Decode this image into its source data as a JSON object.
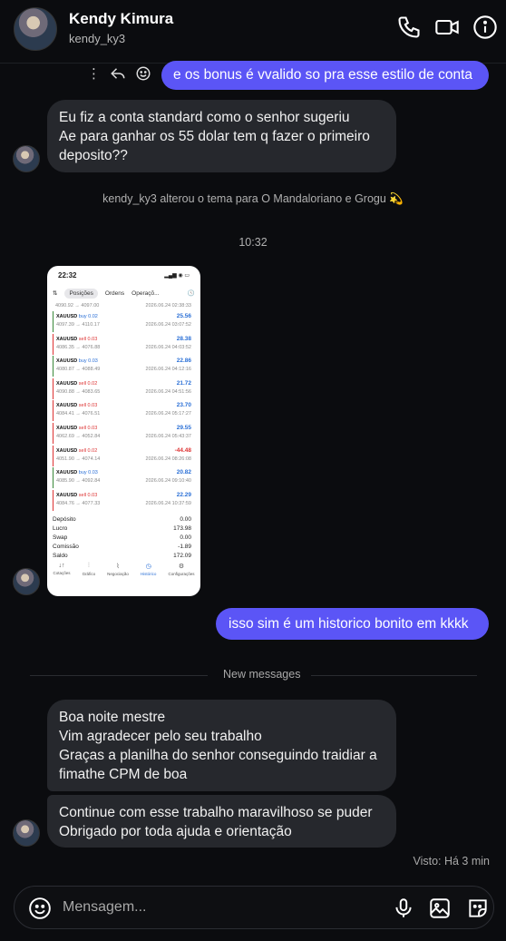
{
  "header": {
    "name": "Kendy Kimura",
    "username": "kendy_ky3",
    "icons": [
      "phone-icon",
      "video-call-icon",
      "info-icon"
    ]
  },
  "messages": {
    "out1": "e os bonus é vvalido so pra esse estilo de conta",
    "in1": [
      "Eu fiz a conta standard como o senhor sugeriu",
      "Ae para ganhar os 55 dolar tem q fazer o primeiro",
      "deposito??"
    ],
    "theme_notice": "kendy_ky3 alterou o tema para O Mandaloriano e Grogu 💫",
    "time": "10:32",
    "out2": "isso sim é um historico bonito em kkkk",
    "new_messages": "New messages",
    "in2": [
      "Boa noite mestre",
      "Vim agradecer pelo seu trabalho",
      "Graças a planilha do senhor conseguindo traidiar a",
      "fimathe CPM de boa"
    ],
    "in3": [
      "Continue com esse trabalho maravilhoso se puder",
      "Obrigado por toda ajuda e orientação"
    ],
    "seen": "Visto: Há 3 min"
  },
  "shared_image": {
    "status_time": "22:32",
    "tabs": [
      "Posições",
      "Ordens",
      "Operaçõ..."
    ],
    "top_row": {
      "prices": "4090.92 → 4097.00",
      "date": "2026.06.24 02:38:33"
    },
    "trades": [
      {
        "symbol": "XAUUSD",
        "dir": "buy 0.02",
        "type": "buy",
        "prices": "4097.39 → 4110.17",
        "pl": "25.56",
        "date": "2026.06.24 03:07:52"
      },
      {
        "symbol": "XAUUSD",
        "dir": "sell 0.03",
        "type": "sell",
        "prices": "4086.35 → 4076.88",
        "pl": "28.38",
        "date": "2026.06.24 04:03:52"
      },
      {
        "symbol": "XAUUSD",
        "dir": "buy 0.03",
        "type": "buy",
        "prices": "4080.87 → 4088.49",
        "pl": "22.86",
        "date": "2026.06.24 04:12:16"
      },
      {
        "symbol": "XAUUSD",
        "dir": "sell 0.02",
        "type": "sell",
        "prices": "4090.88 → 4083.65",
        "pl": "21.72",
        "date": "2026.06.24 04:51:56"
      },
      {
        "symbol": "XAUUSD",
        "dir": "sell 0.03",
        "type": "sell",
        "prices": "4084.41 → 4076.51",
        "pl": "23.70",
        "date": "2026.06.24 05:17:27"
      },
      {
        "symbol": "XAUUSD",
        "dir": "sell 0.03",
        "type": "sell",
        "prices": "4062.69 → 4052.84",
        "pl": "29.55",
        "date": "2026.06.24 05:43:37"
      },
      {
        "symbol": "XAUUSD",
        "dir": "sell 0.02",
        "type": "sell",
        "prices": "4051.90 → 4074.14",
        "pl": "-44.48",
        "date": "2026.06.24 08:26:08"
      },
      {
        "symbol": "XAUUSD",
        "dir": "buy 0.03",
        "type": "buy",
        "prices": "4085.90 → 4092.84",
        "pl": "20.82",
        "date": "2026.06.24 09:10:40"
      },
      {
        "symbol": "XAUUSD",
        "dir": "sell 0.03",
        "type": "sell",
        "prices": "4084.76 → 4077.33",
        "pl": "22.29",
        "date": "2026.06.24 10:37:59"
      }
    ],
    "summary": [
      {
        "label": "Depósito",
        "value": "0.00"
      },
      {
        "label": "Lucro",
        "value": "173.98"
      },
      {
        "label": "Swap",
        "value": "0.00"
      },
      {
        "label": "Comissão",
        "value": "-1.89"
      },
      {
        "label": "Saldo",
        "value": "172.09"
      }
    ],
    "nav": [
      "Cotações",
      "Gráfico",
      "Negociação",
      "Histórico",
      "Configurações"
    ]
  },
  "composer": {
    "placeholder": "Mensagem...",
    "icons": [
      "emoji-icon",
      "microphone-icon",
      "image-icon",
      "sticker-icon"
    ]
  },
  "colors": {
    "outgoing": "#5b55f6",
    "incoming": "#26282d",
    "background": "#0b0c0f"
  }
}
